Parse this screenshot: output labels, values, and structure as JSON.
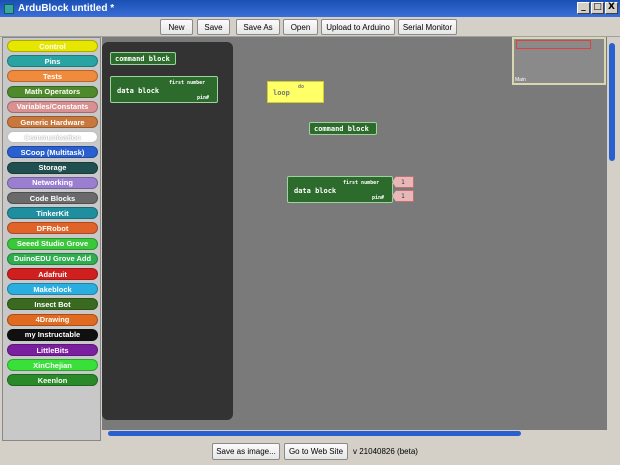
{
  "window": {
    "title": "ArduBlock untitled *",
    "controls": [
      "_",
      "□",
      "X"
    ]
  },
  "toolbar": {
    "buttons": [
      "New",
      "Save",
      "Save As",
      "Open",
      "Upload to Arduino",
      "Serial Monitor"
    ]
  },
  "palette": {
    "categories": [
      {
        "label": "Control",
        "color": "#e6e600"
      },
      {
        "label": "Pins",
        "color": "#2aa3a3"
      },
      {
        "label": "Tests",
        "color": "#f08a3c"
      },
      {
        "label": "Math Operators",
        "color": "#4e8a2b"
      },
      {
        "label": "Variables/Constants",
        "color": "#d99090"
      },
      {
        "label": "Generic Hardware",
        "color": "#c8783c"
      },
      {
        "label": "Communication",
        "color": "#ffffff"
      },
      {
        "label": "SCoop (Multitask)",
        "color": "#2a5fd0"
      },
      {
        "label": "Storage",
        "color": "#1f4f4f"
      },
      {
        "label": "Networking",
        "color": "#9a7fd0"
      },
      {
        "label": "Code Blocks",
        "color": "#6a6a6a"
      },
      {
        "label": "TinkerKit",
        "color": "#1f8f9f"
      },
      {
        "label": "DFRobot",
        "color": "#e0642a"
      },
      {
        "label": "Seeed Studio Grove",
        "color": "#39c83a"
      },
      {
        "label": "DuinoEDU Grove Add",
        "color": "#2fae4f"
      },
      {
        "label": "Adafruit",
        "color": "#d01f1f"
      },
      {
        "label": "Makeblock",
        "color": "#2aaee0"
      },
      {
        "label": "Insect Bot",
        "color": "#3a6a1f"
      },
      {
        "label": "4Drawing",
        "color": "#e06a1f"
      },
      {
        "label": "my Instructable",
        "color": "#101010"
      },
      {
        "label": "LittleBits",
        "color": "#7a1f9f"
      },
      {
        "label": "XinChejian",
        "color": "#39e03a"
      },
      {
        "label": "Keenlon",
        "color": "#2a8a2a"
      }
    ]
  },
  "drawer": {
    "command_block": "command block",
    "data_block": {
      "label": "data block",
      "first_socket": "first number",
      "second_socket": "pin#"
    }
  },
  "workspace": {
    "loop_block": {
      "label": "loop",
      "badge": "do"
    },
    "command_block": "command block",
    "data_block": {
      "label": "data block",
      "first_socket": "first number",
      "second_socket": "pin#",
      "pin_values": [
        "1",
        "1"
      ]
    }
  },
  "minimap": {
    "label": "Main"
  },
  "statusbar": {
    "save_image": "Save as image...",
    "website": "Go to Web Site",
    "version": "v 21040826 (beta)"
  }
}
